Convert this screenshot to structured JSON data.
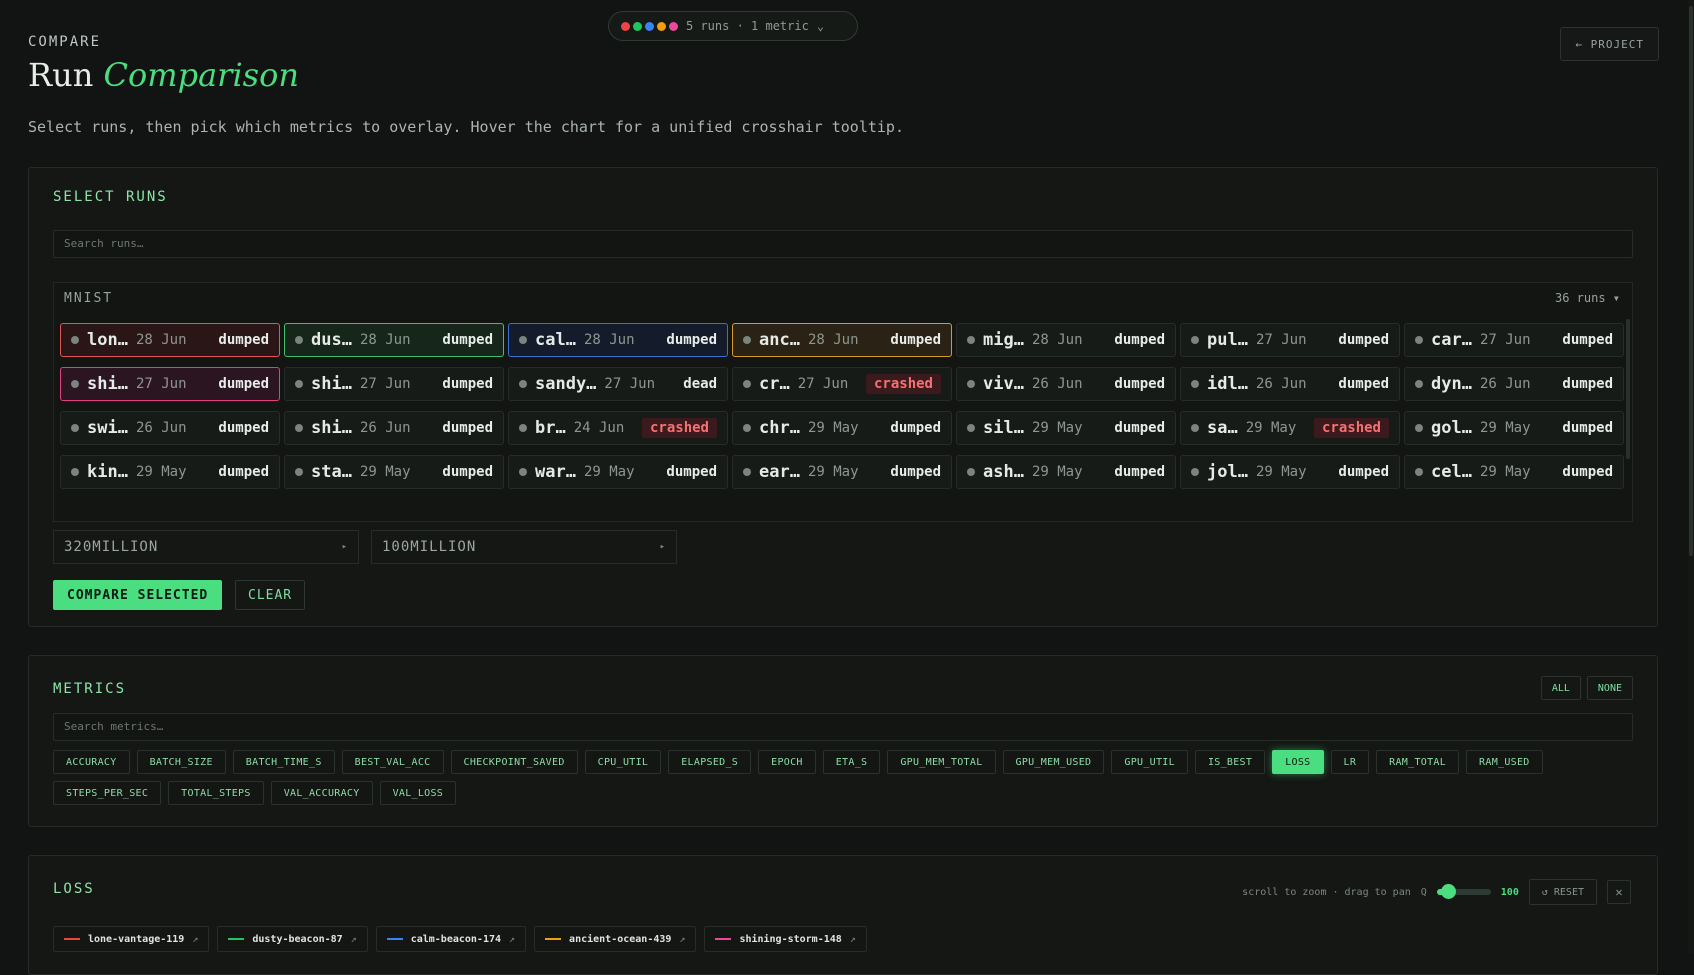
{
  "topbar": {
    "dot_colors": [
      "#ef4444",
      "#22c55e",
      "#3b82f6",
      "#f59e0b",
      "#ec4899"
    ],
    "summary": "5 runs · 1 metric",
    "caret": "⌄",
    "project_button": "← PROJECT"
  },
  "header": {
    "eyebrow": "COMPARE",
    "title_plain": "Run",
    "title_em": "Comparison",
    "subtitle": "Select runs, then pick which metrics to overlay. Hover the chart for a unified crosshair tooltip."
  },
  "select_runs": {
    "title": "SELECT RUNS",
    "search_placeholder": "Search runs…",
    "group_name": "MNIST",
    "group_count": "36 runs ▾",
    "runs": [
      {
        "name": "lon…",
        "date": "28 Jun",
        "status": "dumped",
        "selected": "red"
      },
      {
        "name": "dus…",
        "date": "28 Jun",
        "status": "dumped",
        "selected": "green"
      },
      {
        "name": "cal…",
        "date": "28 Jun",
        "status": "dumped",
        "selected": "blue"
      },
      {
        "name": "anc…",
        "date": "28 Jun",
        "status": "dumped",
        "selected": "amber"
      },
      {
        "name": "mig…",
        "date": "28 Jun",
        "status": "dumped",
        "selected": ""
      },
      {
        "name": "pul…",
        "date": "27 Jun",
        "status": "dumped",
        "selected": ""
      },
      {
        "name": "car…",
        "date": "27 Jun",
        "status": "dumped",
        "selected": ""
      },
      {
        "name": "shi…",
        "date": "27 Jun",
        "status": "dumped",
        "selected": "pink"
      },
      {
        "name": "shi…",
        "date": "27 Jun",
        "status": "dumped",
        "selected": ""
      },
      {
        "name": "sandy…",
        "date": "27 Jun",
        "status": "dead",
        "selected": ""
      },
      {
        "name": "cr…",
        "date": "27 Jun",
        "status": "crashed",
        "selected": ""
      },
      {
        "name": "viv…",
        "date": "26 Jun",
        "status": "dumped",
        "selected": ""
      },
      {
        "name": "idl…",
        "date": "26 Jun",
        "status": "dumped",
        "selected": ""
      },
      {
        "name": "dyn…",
        "date": "26 Jun",
        "status": "dumped",
        "selected": ""
      },
      {
        "name": "swi…",
        "date": "26 Jun",
        "status": "dumped",
        "selected": ""
      },
      {
        "name": "shi…",
        "date": "26 Jun",
        "status": "dumped",
        "selected": ""
      },
      {
        "name": "br…",
        "date": "24 Jun",
        "status": "crashed",
        "selected": ""
      },
      {
        "name": "chr…",
        "date": "29 May",
        "status": "dumped",
        "selected": ""
      },
      {
        "name": "sil…",
        "date": "29 May",
        "status": "dumped",
        "selected": ""
      },
      {
        "name": "sa…",
        "date": "29 May",
        "status": "crashed",
        "selected": ""
      },
      {
        "name": "gol…",
        "date": "29 May",
        "status": "dumped",
        "selected": ""
      },
      {
        "name": "kin…",
        "date": "29 May",
        "status": "dumped",
        "selected": ""
      },
      {
        "name": "sta…",
        "date": "29 May",
        "status": "dumped",
        "selected": ""
      },
      {
        "name": "war…",
        "date": "29 May",
        "status": "dumped",
        "selected": ""
      },
      {
        "name": "ear…",
        "date": "29 May",
        "status": "dumped",
        "selected": ""
      },
      {
        "name": "ash…",
        "date": "29 May",
        "status": "dumped",
        "selected": ""
      },
      {
        "name": "jol…",
        "date": "29 May",
        "status": "dumped",
        "selected": ""
      },
      {
        "name": "cel…",
        "date": "29 May",
        "status": "dumped",
        "selected": ""
      }
    ],
    "folders": [
      "320MILLION",
      "100MILLION"
    ],
    "compare_button": "COMPARE SELECTED",
    "clear_button": "CLEAR"
  },
  "metrics": {
    "title": "METRICS",
    "all_button": "ALL",
    "none_button": "NONE",
    "search_placeholder": "Search metrics…",
    "items": [
      {
        "label": "ACCURACY",
        "on": false
      },
      {
        "label": "BATCH_SIZE",
        "on": false
      },
      {
        "label": "BATCH_TIME_S",
        "on": false
      },
      {
        "label": "BEST_VAL_ACC",
        "on": false
      },
      {
        "label": "CHECKPOINT_SAVED",
        "on": false
      },
      {
        "label": "CPU_UTIL",
        "on": false
      },
      {
        "label": "ELAPSED_S",
        "on": false
      },
      {
        "label": "EPOCH",
        "on": false
      },
      {
        "label": "ETA_S",
        "on": false
      },
      {
        "label": "GPU_MEM_TOTAL",
        "on": false
      },
      {
        "label": "GPU_MEM_USED",
        "on": false
      },
      {
        "label": "GPU_UTIL",
        "on": false
      },
      {
        "label": "IS_BEST",
        "on": false
      },
      {
        "label": "LOSS",
        "on": true
      },
      {
        "label": "LR",
        "on": false
      },
      {
        "label": "RAM_TOTAL",
        "on": false
      },
      {
        "label": "RAM_USED",
        "on": false
      },
      {
        "label": "STEPS_PER_SEC",
        "on": false
      },
      {
        "label": "TOTAL_STEPS",
        "on": false
      },
      {
        "label": "VAL_ACCURACY",
        "on": false
      },
      {
        "label": "VAL_LOSS",
        "on": false
      }
    ]
  },
  "loss_panel": {
    "title": "LOSS",
    "hint": "scroll to zoom · drag to pan",
    "zoom_icon_label": "Q",
    "zoom_value": "100",
    "zoom_fraction": 0.2,
    "reset_button": "↺ RESET",
    "close_glyph": "✕",
    "legend": [
      {
        "name": "lone-vantage-119",
        "color": "#ef4444"
      },
      {
        "name": "dusty-beacon-87",
        "color": "#22c55e"
      },
      {
        "name": "calm-beacon-174",
        "color": "#3b82f6"
      },
      {
        "name": "ancient-ocean-439",
        "color": "#f59e0b"
      },
      {
        "name": "shining-storm-148",
        "color": "#ec4899"
      }
    ],
    "legend_ext_glyph": "↗"
  }
}
